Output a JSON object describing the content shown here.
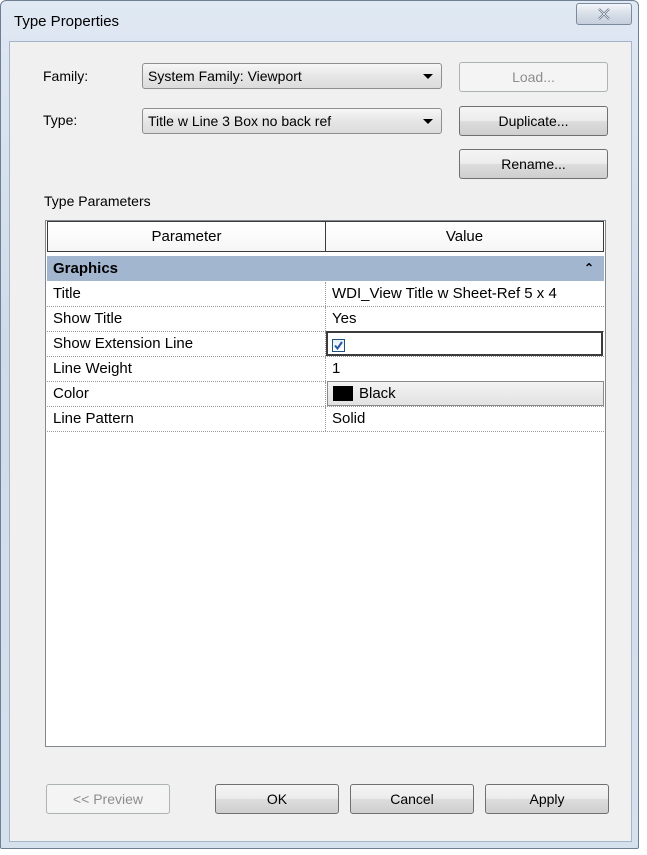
{
  "window": {
    "title": "Type Properties"
  },
  "family": {
    "label": "Family:",
    "value": "System Family: Viewport"
  },
  "type": {
    "label": "Type:",
    "value": "Title w Line 3 Box no back ref"
  },
  "buttons": {
    "load": "Load...",
    "duplicate": "Duplicate...",
    "rename": "Rename...",
    "preview": "<< Preview",
    "ok": "OK",
    "cancel": "Cancel",
    "apply": "Apply"
  },
  "type_parameters": {
    "label": "Type Parameters",
    "columns": [
      "Parameter",
      "Value"
    ],
    "groups": [
      {
        "name": "Graphics",
        "collapse_icon": "double-chevron-up-icon",
        "rows": [
          {
            "parameter": "Title",
            "value": "WDI_View Title w Sheet-Ref 5 x 4"
          },
          {
            "parameter": "Show Title",
            "value": "Yes"
          },
          {
            "parameter": "Show Extension Line",
            "checked": true
          },
          {
            "parameter": "Line Weight",
            "value": "1"
          },
          {
            "parameter": "Color",
            "value": "Black",
            "swatch_color": "#000000"
          },
          {
            "parameter": "Line Pattern",
            "value": "Solid"
          }
        ]
      }
    ]
  },
  "colors": {
    "group_header": "#a3b6cf",
    "checkbox_tick": "#2a56a8"
  }
}
